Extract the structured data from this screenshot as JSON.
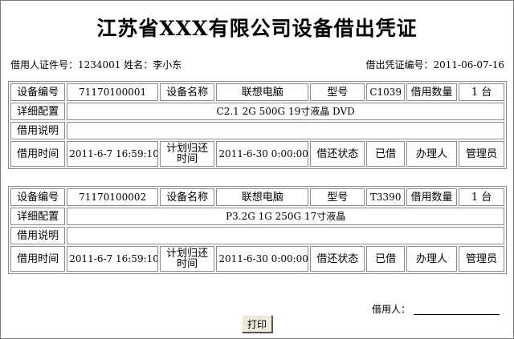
{
  "title": "江苏省XXX有限公司设备借出凭证",
  "borrower_id_text": "借用人证件号：1234001 姓名：李小东",
  "voucher_no_text": "借出凭证编号：2011-06-07-16",
  "labels": {
    "device_no": "设备编号",
    "device_name": "设备名称",
    "model": "型号",
    "quantity": "借用数量",
    "config": "详细配置",
    "note": "借用说明",
    "borrow_time": "借用时间",
    "planned_return": "计划归还时间",
    "return_status": "借还状态",
    "handler": "办理人"
  },
  "records": [
    {
      "device_no": "71170100001",
      "device_name": "联想电脑",
      "model": "C1039",
      "quantity": "1 台",
      "config": "C2.1 2G 500G 19寸液晶  DVD",
      "note": "",
      "borrow_time": "2011-6-7 16:59:10",
      "planned_return": "2011-6-30 0:00:00",
      "status": "已借",
      "handler": "管理员"
    },
    {
      "device_no": "71170100002",
      "device_name": "联想电脑",
      "model": "T3390",
      "quantity": "1 台",
      "config": "P3.2G 1G 250G 17寸液晶",
      "note": "",
      "borrow_time": "2011-6-7 16:59:10",
      "planned_return": "2011-6-30 0:00:00",
      "status": "已借",
      "handler": "管理员"
    }
  ],
  "signer_label": "借用人：",
  "print_button": "打印"
}
